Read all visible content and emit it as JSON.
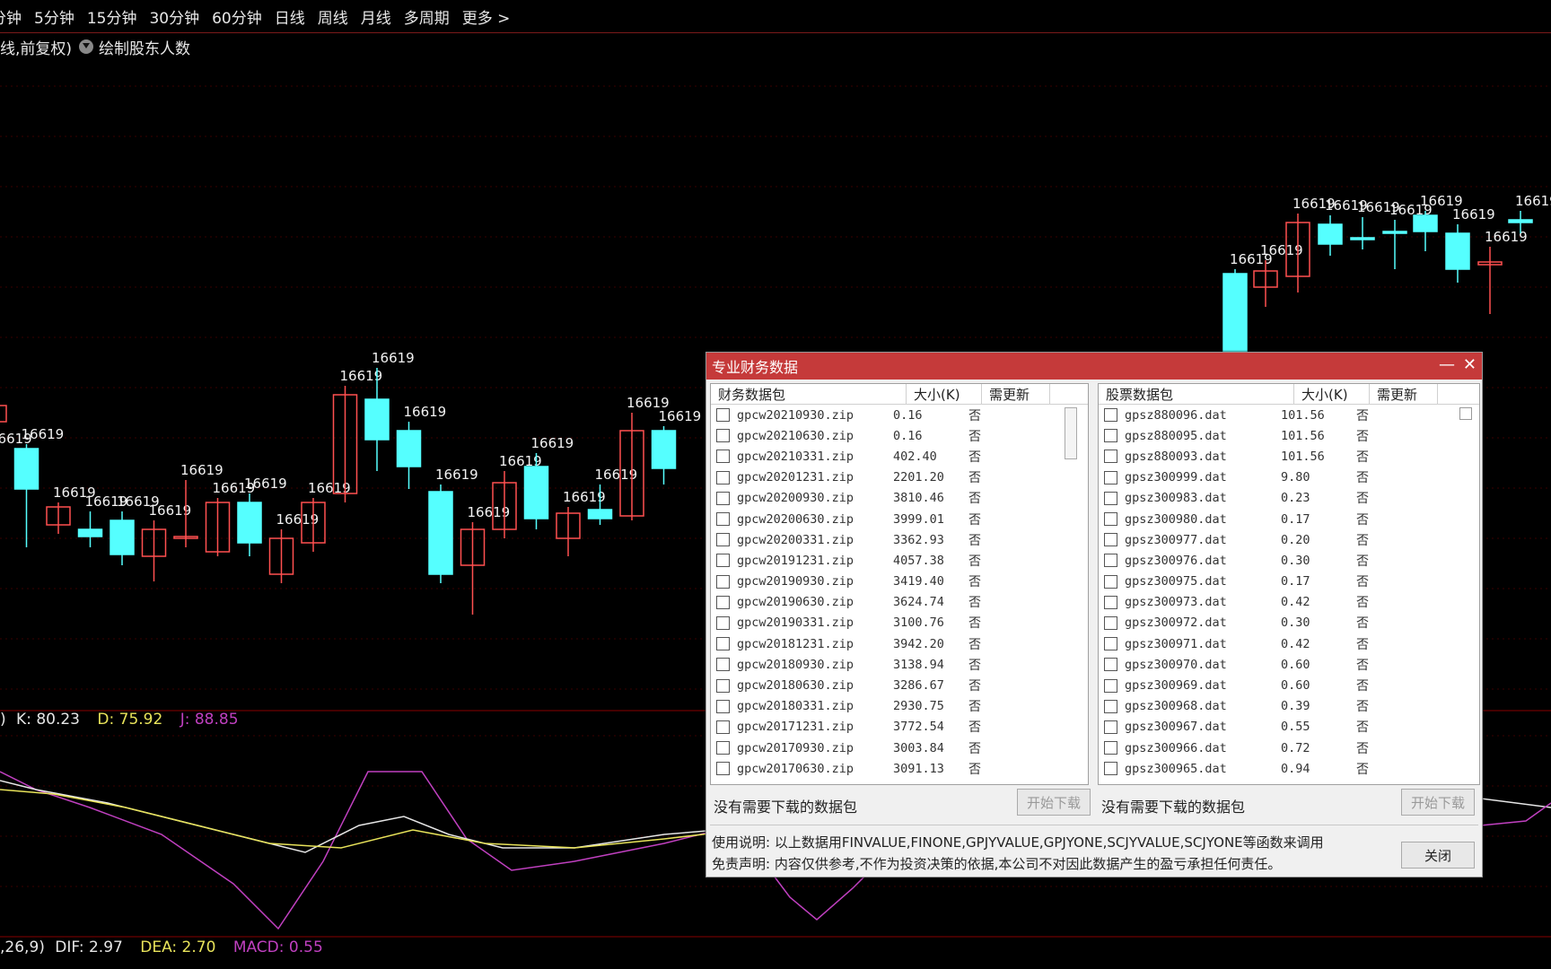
{
  "toolbar": {
    "items": [
      "分钟",
      "5分钟",
      "15分钟",
      "30分钟",
      "60分钟",
      "日线",
      "周线",
      "月线",
      "多周期",
      "更多 >"
    ]
  },
  "indicator": {
    "prefix": "线,前复权)",
    "draw_label": "绘制股东人数"
  },
  "kdj": {
    "lead": ")",
    "k": "K: 80.23",
    "d": "D: 75.92",
    "j": "J: 88.85",
    "colors": {
      "k": "#e6e6e6",
      "d": "#e8e35a",
      "j": "#c040c0",
      "down": "#55e0e0",
      "up": "#ff5050"
    }
  },
  "macd": {
    "lead": ",26,9)",
    "dif": "DIF: 2.97",
    "dea": "DEA: 2.70",
    "macd": "MACD: 0.55",
    "colors": {
      "dif": "#e6e6e6",
      "dea": "#e8e35a",
      "macd": "#c040c0"
    }
  },
  "chart_data": {
    "type": "candlestick",
    "candle_label": "16619",
    "colors": {
      "up": "#ff5050",
      "down": "#55ffff",
      "bg": "#000000",
      "grid": "#5a0000"
    },
    "candles": [
      [
        470,
        452,
        500,
        505
      ],
      [
        500,
        545,
        495,
        610
      ],
      [
        585,
        565,
        560,
        595
      ],
      [
        590,
        598,
        570,
        610
      ],
      [
        580,
        618,
        570,
        630
      ],
      [
        620,
        590,
        580,
        648
      ],
      [
        600,
        598,
        535,
        610
      ],
      [
        615,
        560,
        555,
        620
      ],
      [
        560,
        605,
        550,
        620
      ],
      [
        640,
        600,
        590,
        650
      ],
      [
        605,
        560,
        555,
        615
      ],
      [
        550,
        440,
        430,
        560
      ],
      [
        445,
        490,
        410,
        525
      ],
      [
        480,
        520,
        470,
        545
      ],
      [
        548,
        640,
        540,
        650
      ],
      [
        630,
        590,
        582,
        685
      ],
      [
        590,
        538,
        525,
        600
      ],
      [
        520,
        578,
        505,
        590
      ],
      [
        600,
        572,
        565,
        620
      ],
      [
        568,
        578,
        540,
        585
      ],
      [
        575,
        480,
        460,
        580
      ],
      [
        480,
        522,
        475,
        540
      ],
      [
        305,
        400,
        300,
        408
      ],
      [
        320,
        302,
        290,
        342
      ],
      [
        308,
        248,
        238,
        326
      ],
      [
        250,
        272,
        240,
        285
      ],
      [
        265,
        265,
        242,
        278
      ],
      [
        258,
        260,
        245,
        300
      ],
      [
        240,
        258,
        235,
        280
      ],
      [
        260,
        300,
        250,
        315
      ],
      [
        295,
        292,
        275,
        350
      ],
      [
        245,
        248,
        235,
        260
      ]
    ]
  },
  "dialog": {
    "title": "专业财务数据",
    "minimize": "—",
    "close_x": "✕",
    "left": {
      "headers": [
        "财务数据包",
        "大小(K)",
        "需更新"
      ],
      "rows": [
        [
          "gpcw20210930.zip",
          "0.16",
          "否"
        ],
        [
          "gpcw20210630.zip",
          "0.16",
          "否"
        ],
        [
          "gpcw20210331.zip",
          "402.40",
          "否"
        ],
        [
          "gpcw20201231.zip",
          "2201.20",
          "否"
        ],
        [
          "gpcw20200930.zip",
          "3810.46",
          "否"
        ],
        [
          "gpcw20200630.zip",
          "3999.01",
          "否"
        ],
        [
          "gpcw20200331.zip",
          "3362.93",
          "否"
        ],
        [
          "gpcw20191231.zip",
          "4057.38",
          "否"
        ],
        [
          "gpcw20190930.zip",
          "3419.40",
          "否"
        ],
        [
          "gpcw20190630.zip",
          "3624.74",
          "否"
        ],
        [
          "gpcw20190331.zip",
          "3100.76",
          "否"
        ],
        [
          "gpcw20181231.zip",
          "3942.20",
          "否"
        ],
        [
          "gpcw20180930.zip",
          "3138.94",
          "否"
        ],
        [
          "gpcw20180630.zip",
          "3286.67",
          "否"
        ],
        [
          "gpcw20180331.zip",
          "2930.75",
          "否"
        ],
        [
          "gpcw20171231.zip",
          "3772.54",
          "否"
        ],
        [
          "gpcw20170930.zip",
          "3003.84",
          "否"
        ],
        [
          "gpcw20170630.zip",
          "3091.13",
          "否"
        ]
      ],
      "status": "没有需要下载的数据包",
      "button": "开始下载"
    },
    "right": {
      "headers": [
        "股票数据包",
        "大小(K)",
        "需更新"
      ],
      "rows": [
        [
          "gpsz880096.dat",
          "101.56",
          "否"
        ],
        [
          "gpsz880095.dat",
          "101.56",
          "否"
        ],
        [
          "gpsz880093.dat",
          "101.56",
          "否"
        ],
        [
          "gpsz300999.dat",
          "9.80",
          "否"
        ],
        [
          "gpsz300983.dat",
          "0.23",
          "否"
        ],
        [
          "gpsz300980.dat",
          "0.17",
          "否"
        ],
        [
          "gpsz300977.dat",
          "0.20",
          "否"
        ],
        [
          "gpsz300976.dat",
          "0.30",
          "否"
        ],
        [
          "gpsz300975.dat",
          "0.17",
          "否"
        ],
        [
          "gpsz300973.dat",
          "0.42",
          "否"
        ],
        [
          "gpsz300972.dat",
          "0.30",
          "否"
        ],
        [
          "gpsz300971.dat",
          "0.42",
          "否"
        ],
        [
          "gpsz300970.dat",
          "0.60",
          "否"
        ],
        [
          "gpsz300969.dat",
          "0.60",
          "否"
        ],
        [
          "gpsz300968.dat",
          "0.39",
          "否"
        ],
        [
          "gpsz300967.dat",
          "0.55",
          "否"
        ],
        [
          "gpsz300966.dat",
          "0.72",
          "否"
        ],
        [
          "gpsz300965.dat",
          "0.94",
          "否"
        ]
      ],
      "status": "没有需要下载的数据包",
      "button": "开始下载"
    },
    "usage": "使用说明: 以上数据用FINVALUE,FINONE,GPJYVALUE,GPJYONE,SCJYVALUE,SCJYONE等函数来调用",
    "disclaimer": "免责声明: 内容仅供参考,不作为投资决策的依据,本公司不对因此数据产生的盈亏承担任何责任。",
    "close_button": "关闭"
  }
}
